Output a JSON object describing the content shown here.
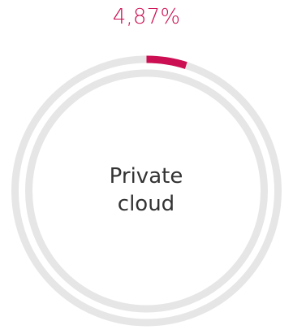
{
  "chart_data": {
    "type": "pie",
    "percent_label": "4,87%",
    "value_percent": 4.87,
    "center_label_lines": [
      "Private",
      "cloud"
    ],
    "colors": {
      "accent": "#cc0e52",
      "track": "#e6e6e6",
      "text": "#333333"
    }
  }
}
